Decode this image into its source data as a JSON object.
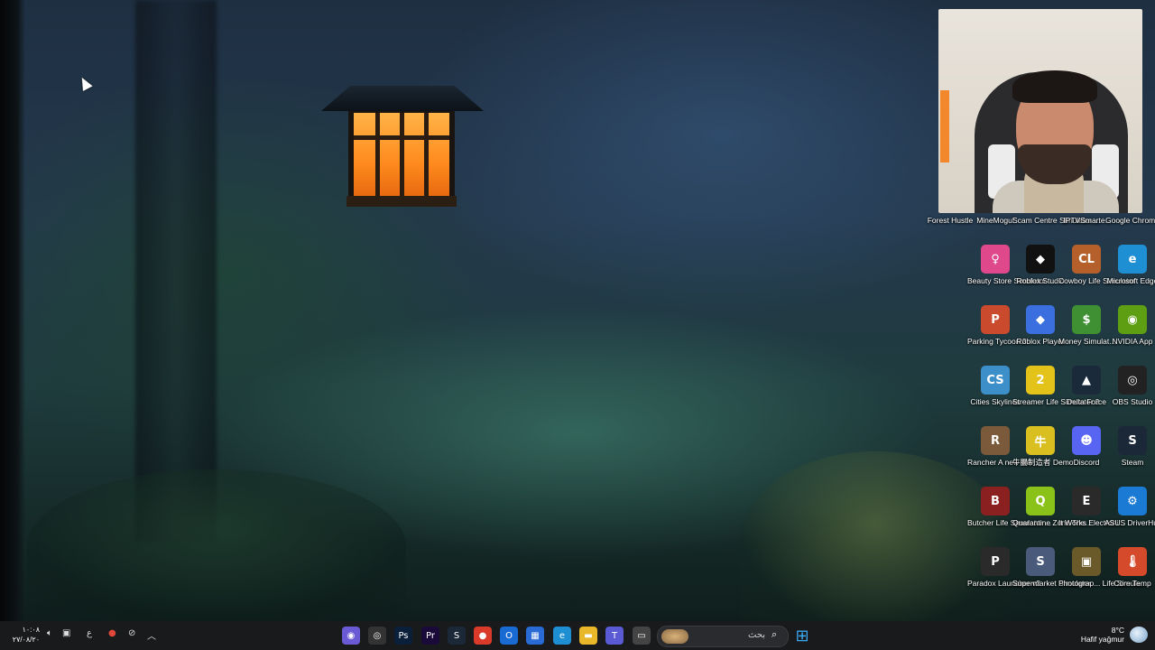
{
  "desktop": {
    "top_row_labels": [
      "Forest Hustle",
      "MineMogul",
      "Scam Centre Simulator ...",
      "IPTVSmarte...",
      "Google Chrome"
    ],
    "icons": [
      {
        "label": "Beauty Store Simulator ...",
        "icon": "beauty-store-icon",
        "glyph": "♀",
        "color": "#e0488c"
      },
      {
        "label": "Roblox Studio",
        "icon": "roblox-studio-icon",
        "glyph": "◆",
        "color": "#111111"
      },
      {
        "label": "Cowboy Life Simulator",
        "icon": "cowboy-life-icon",
        "glyph": "CL",
        "color": "#b5602a"
      },
      {
        "label": "Microsoft Edge",
        "icon": "edge-icon",
        "glyph": "e",
        "color": "#1f8fd4"
      },
      {
        "label": "Parking Tycoon 2",
        "icon": "parking-tycoon-icon",
        "glyph": "P",
        "color": "#c94a2c"
      },
      {
        "label": "Roblox Player",
        "icon": "roblox-player-icon",
        "glyph": "◆",
        "color": "#3b6fe0"
      },
      {
        "label": "Money Simulat...",
        "icon": "money-simulator-icon",
        "glyph": "$",
        "color": "#3f8f33"
      },
      {
        "label": "NVIDIA App",
        "icon": "nvidia-icon",
        "glyph": "◉",
        "color": "#5d9e13"
      },
      {
        "label": "Cities Skylines",
        "icon": "cities-skylines-icon",
        "glyph": "CS",
        "color": "#3d8fc9"
      },
      {
        "label": "Streamer Life Simulator 2",
        "icon": "streamer-life-icon",
        "glyph": "2",
        "color": "#e3c21a"
      },
      {
        "label": "Delta Force",
        "icon": "delta-force-icon",
        "glyph": "▲",
        "color": "#1a2a3a"
      },
      {
        "label": "OBS Studio",
        "icon": "obs-icon",
        "glyph": "◎",
        "color": "#222222"
      },
      {
        "label": "Rancher A new life ...",
        "icon": "rancher-icon",
        "glyph": "R",
        "color": "#7a5a3a"
      },
      {
        "label": "牛腸制造者 Demo",
        "icon": "sausage-maker-icon",
        "glyph": "牛",
        "color": "#d9c020"
      },
      {
        "label": "Discord",
        "icon": "discord-icon",
        "glyph": "☻",
        "color": "#5865f2"
      },
      {
        "label": "Steam",
        "icon": "steam-icon",
        "glyph": "S",
        "color": "#1b2838"
      },
      {
        "label": "Butcher Life Simulator ...",
        "icon": "butcher-life-icon",
        "glyph": "B",
        "color": "#8a2020"
      },
      {
        "label": "Quarantine Zone The...",
        "icon": "quarantine-zone-icon",
        "glyph": "Q",
        "color": "#8ac21a"
      },
      {
        "label": "It Works Electroni...",
        "icon": "it-works-icon",
        "glyph": "E",
        "color": "#2a2a2a"
      },
      {
        "label": "ASUS DriverHub",
        "icon": "asus-driverhub-icon",
        "glyph": "⚙",
        "color": "#1a7ad4"
      },
      {
        "label": "Paradox Launcher v2",
        "icon": "paradox-launcher-icon",
        "glyph": "P",
        "color": "#2a2a2a"
      },
      {
        "label": "Supermarket Simulator",
        "icon": "supermarket-icon",
        "glyph": "S",
        "color": "#4a5a7a"
      },
      {
        "label": "Photograp... Life Simula...",
        "icon": "photographer-life-icon",
        "glyph": "▣",
        "color": "#6a5a2a"
      },
      {
        "label": "Core Temp",
        "icon": "core-temp-icon",
        "glyph": "🌡",
        "color": "#d44a2a"
      }
    ]
  },
  "taskbar": {
    "apps": [
      {
        "name": "copilot-icon",
        "glyph": "◉",
        "color": "#6a5ad4"
      },
      {
        "name": "obs-taskbar-icon",
        "glyph": "◎",
        "color": "#333333"
      },
      {
        "name": "photoshop-icon",
        "glyph": "Ps",
        "color": "#0a1f3a"
      },
      {
        "name": "premiere-icon",
        "glyph": "Pr",
        "color": "#1a0a3a"
      },
      {
        "name": "steam-taskbar-icon",
        "glyph": "S",
        "color": "#1b2838"
      },
      {
        "name": "chrome-icon",
        "glyph": "●",
        "color": "#d93a2a"
      },
      {
        "name": "outlook-icon",
        "glyph": "O",
        "color": "#1a6ad4"
      },
      {
        "name": "store-icon",
        "glyph": "▦",
        "color": "#2a6ad4"
      },
      {
        "name": "edge-taskbar-icon",
        "glyph": "e",
        "color": "#1f8fd4"
      },
      {
        "name": "file-explorer-icon",
        "glyph": "▬",
        "color": "#e8b82a"
      },
      {
        "name": "teams-icon",
        "glyph": "T",
        "color": "#5a5ad4"
      },
      {
        "name": "task-view-icon",
        "glyph": "▭",
        "color": "#444444"
      }
    ],
    "search_placeholder": "بحث",
    "start_glyph": "⊞",
    "clock_time": "١٠:٠٨",
    "clock_date": "٢٧/٠٨/٢٠",
    "language": "ع",
    "weather_temp": "8°C",
    "weather_desc": "Hafif yağmur"
  }
}
